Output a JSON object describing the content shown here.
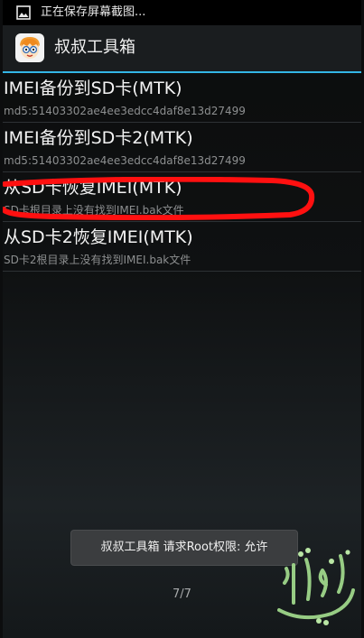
{
  "status_bar": {
    "notification_text": "正在保存屏幕截图...",
    "icon": "image-icon"
  },
  "action_bar": {
    "title": "叔叔工具箱",
    "icon": "app-face-icon",
    "accent_color": "#33b5e5"
  },
  "list": {
    "items": [
      {
        "title": "IMEI备份到SD卡(MTK)",
        "subtitle": "md5:51403302ae4ee3edcc4daf8e13d27499"
      },
      {
        "title": "IMEI备份到SD卡2(MTK)",
        "subtitle": "md5:51403302ae4ee3edcc4daf8e13d27499"
      },
      {
        "title": "从SD卡恢复IMEI(MTK)",
        "subtitle": "SD卡根目录上没有找到IMEI.bak文件"
      },
      {
        "title": "从SD卡2恢复IMEI(MTK)",
        "subtitle": "SD卡2根目录上没有找到IMEI.bak文件"
      }
    ],
    "highlight_color": "#ff1010"
  },
  "toast": {
    "message": "叔叔工具箱 请求Root权限: 允许"
  },
  "page_indicator": "7/7"
}
